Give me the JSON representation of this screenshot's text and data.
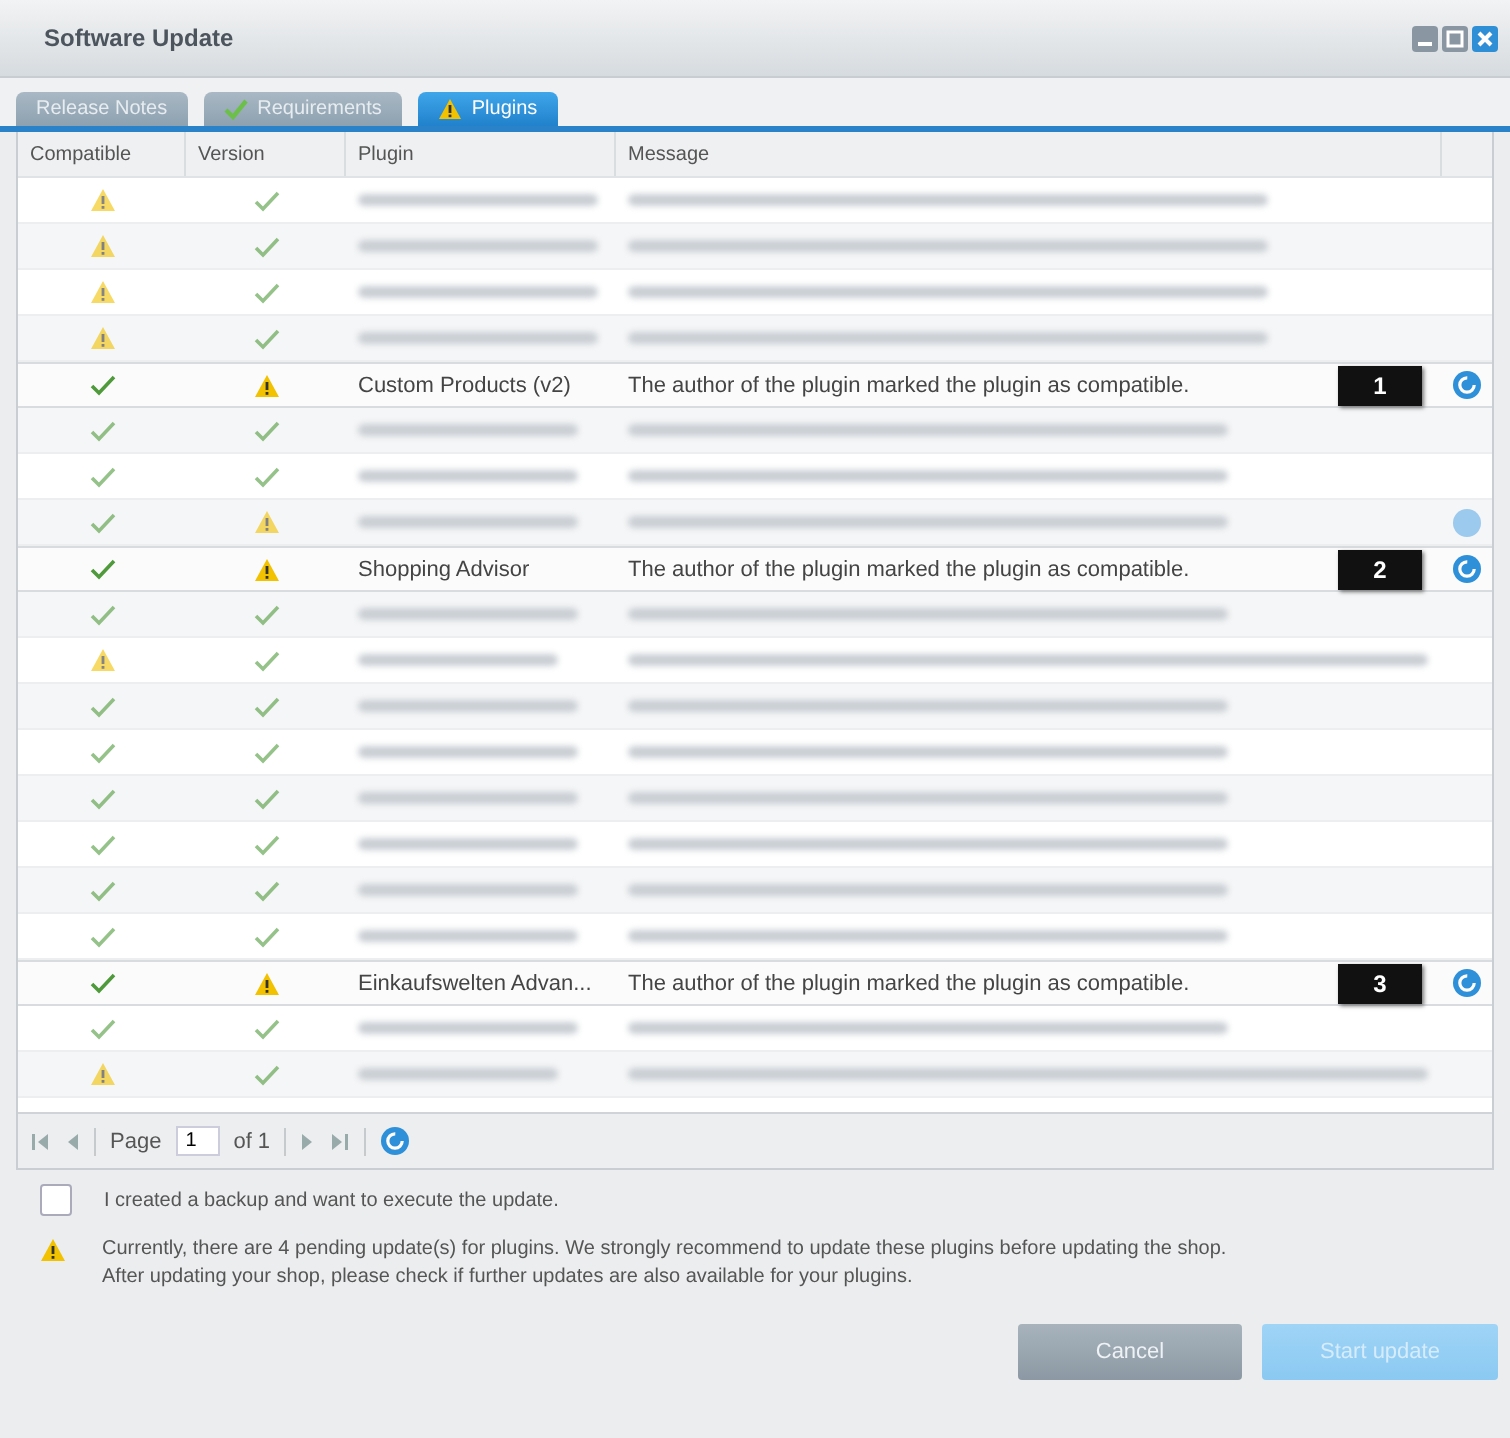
{
  "window": {
    "title": "Software Update"
  },
  "tabs": [
    {
      "label": "Release Notes",
      "kind": "plain",
      "selected": false
    },
    {
      "label": "Requirements",
      "kind": "passed",
      "selected": false
    },
    {
      "label": "Plugins",
      "kind": "warning",
      "selected": true
    }
  ],
  "table": {
    "columns": [
      "Compatible",
      "Version",
      "Plugin",
      "Message"
    ],
    "rows": [
      {
        "compatible": false,
        "version_ok": true,
        "blurred": true,
        "kind": "unavailable",
        "update": false
      },
      {
        "compatible": false,
        "version_ok": true,
        "blurred": true,
        "kind": "unavailable",
        "update": false
      },
      {
        "compatible": false,
        "version_ok": true,
        "blurred": true,
        "kind": "unavailable",
        "update": false
      },
      {
        "compatible": false,
        "version_ok": true,
        "blurred": true,
        "kind": "unavailable",
        "update": false
      },
      {
        "compatible": true,
        "version_ok": false,
        "blurred": false,
        "plugin": "Custom Products (v2)",
        "message": "The author of the plugin marked the plugin as compatible.",
        "marker": "1",
        "update": true,
        "faded": false
      },
      {
        "compatible": true,
        "version_ok": true,
        "blurred": true,
        "kind": "compatible",
        "update": false
      },
      {
        "compatible": true,
        "version_ok": true,
        "blurred": true,
        "kind": "compatible",
        "update": false
      },
      {
        "compatible": true,
        "version_ok": false,
        "blurred": true,
        "kind": "compatible",
        "update": true,
        "faded": true
      },
      {
        "compatible": true,
        "version_ok": false,
        "blurred": false,
        "plugin": "Shopping Advisor",
        "message": "The author of the plugin marked the plugin as compatible.",
        "marker": "2",
        "update": true,
        "faded": false
      },
      {
        "compatible": true,
        "version_ok": true,
        "blurred": true,
        "kind": "compatible",
        "update": false
      },
      {
        "compatible": false,
        "version_ok": true,
        "blurred": true,
        "kind": "unmarked",
        "update": false
      },
      {
        "compatible": true,
        "version_ok": true,
        "blurred": true,
        "kind": "compatible",
        "update": false
      },
      {
        "compatible": true,
        "version_ok": true,
        "blurred": true,
        "kind": "compatible",
        "update": false
      },
      {
        "compatible": true,
        "version_ok": true,
        "blurred": true,
        "kind": "compatible",
        "update": false
      },
      {
        "compatible": true,
        "version_ok": true,
        "blurred": true,
        "kind": "compatible",
        "update": false
      },
      {
        "compatible": true,
        "version_ok": true,
        "blurred": true,
        "kind": "compatible",
        "update": false
      },
      {
        "compatible": true,
        "version_ok": true,
        "blurred": true,
        "kind": "compatible",
        "update": false
      },
      {
        "compatible": true,
        "version_ok": false,
        "blurred": false,
        "plugin": "Einkaufswelten Advan...",
        "message": "The author of the plugin marked the plugin as compatible.",
        "marker": "3",
        "update": true,
        "faded": false
      },
      {
        "compatible": true,
        "version_ok": true,
        "blurred": true,
        "kind": "compatible",
        "update": false
      },
      {
        "compatible": false,
        "version_ok": true,
        "blurred": true,
        "kind": "unmarked",
        "update": false
      }
    ]
  },
  "pager": {
    "page_label": "Page",
    "page": "1",
    "of_label": "of 1"
  },
  "backup": {
    "label": "I created a backup and want to execute the update.",
    "checked": false
  },
  "notice": {
    "lines": [
      "Currently, there are 4 pending update(s) for plugins. We strongly recommend to update these plugins before updating the shop.",
      "After updating your shop, please check if further updates are also available for your plugins."
    ]
  },
  "buttons": [
    {
      "label": "Cancel",
      "disabled": false
    },
    {
      "label": "Start update",
      "disabled": true
    }
  ]
}
